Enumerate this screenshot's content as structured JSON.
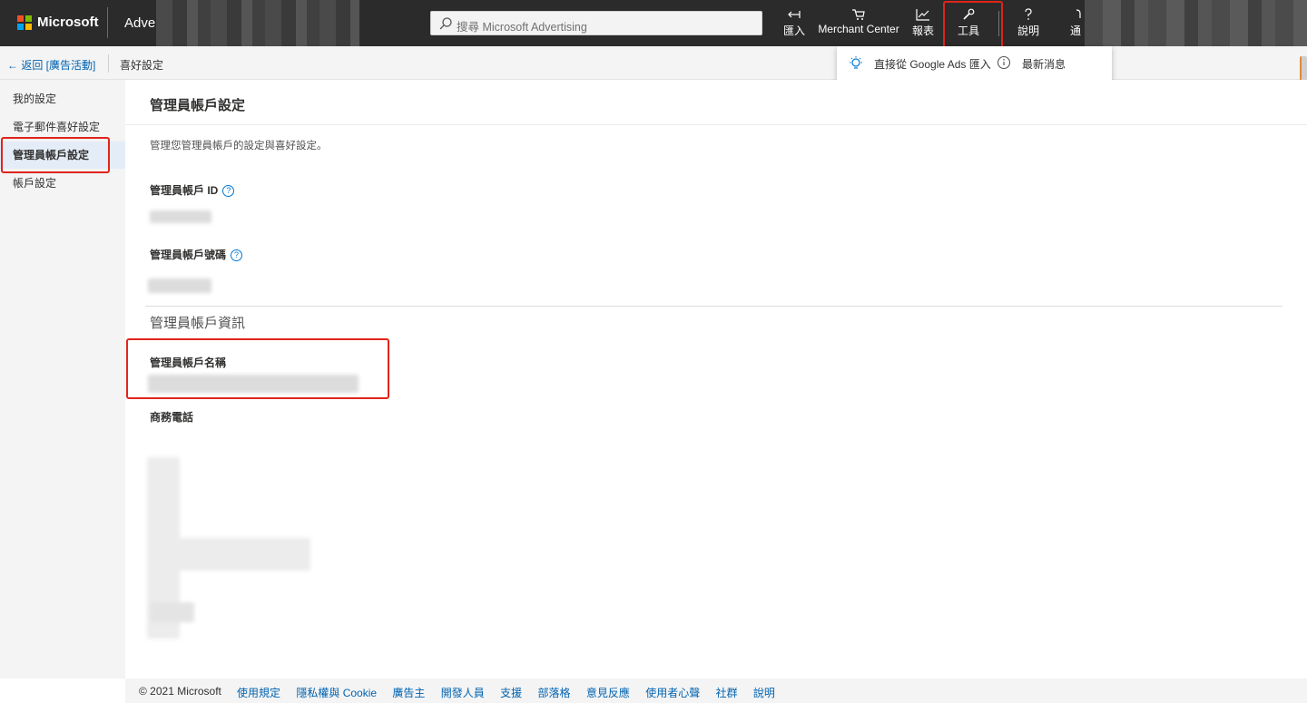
{
  "brand": {
    "company": "Microsoft",
    "product": "Adve"
  },
  "search": {
    "placeholder": "搜尋 Microsoft Advertising"
  },
  "nav": {
    "import": "匯入",
    "merchant_center": "Merchant Center",
    "reports": "報表",
    "tools": "工具",
    "help": "說明",
    "more": "通"
  },
  "tools_menu": {
    "import_google": "直接從 Google Ads 匯入",
    "whats_new": "最新消息"
  },
  "subheader": {
    "back_label": "← 返回 [廣告活動]",
    "breadcrumb": "喜好設定"
  },
  "sidebar": {
    "items": [
      {
        "label": "我的設定"
      },
      {
        "label": "電子郵件喜好設定"
      },
      {
        "label": "管理員帳戶設定"
      },
      {
        "label": "帳戶設定"
      }
    ]
  },
  "main": {
    "title": "管理員帳戶設定",
    "description": "管理您管理員帳戶的設定與喜好設定。",
    "account_id_label": "管理員帳戶 ID",
    "account_number_label": "管理員帳戶號碼",
    "info_section_title": "管理員帳戶資訊",
    "account_name_label": "管理員帳戶名稱",
    "business_phone_label": "商務電話",
    "help_glyph": "?"
  },
  "footer": {
    "copyright": "© 2021 Microsoft",
    "links": [
      "使用規定",
      "隱私權與 Cookie",
      "廣告主",
      "開發人員",
      "支援",
      "部落格",
      "意見反應",
      "使用者心聲",
      "社群",
      "說明"
    ]
  },
  "colors": {
    "topbar": "#2b2b2b",
    "link": "#0063b1",
    "highlight": "#e0241b",
    "logo": [
      "#f25022",
      "#7fba00",
      "#00a4ef",
      "#ffb900"
    ]
  }
}
